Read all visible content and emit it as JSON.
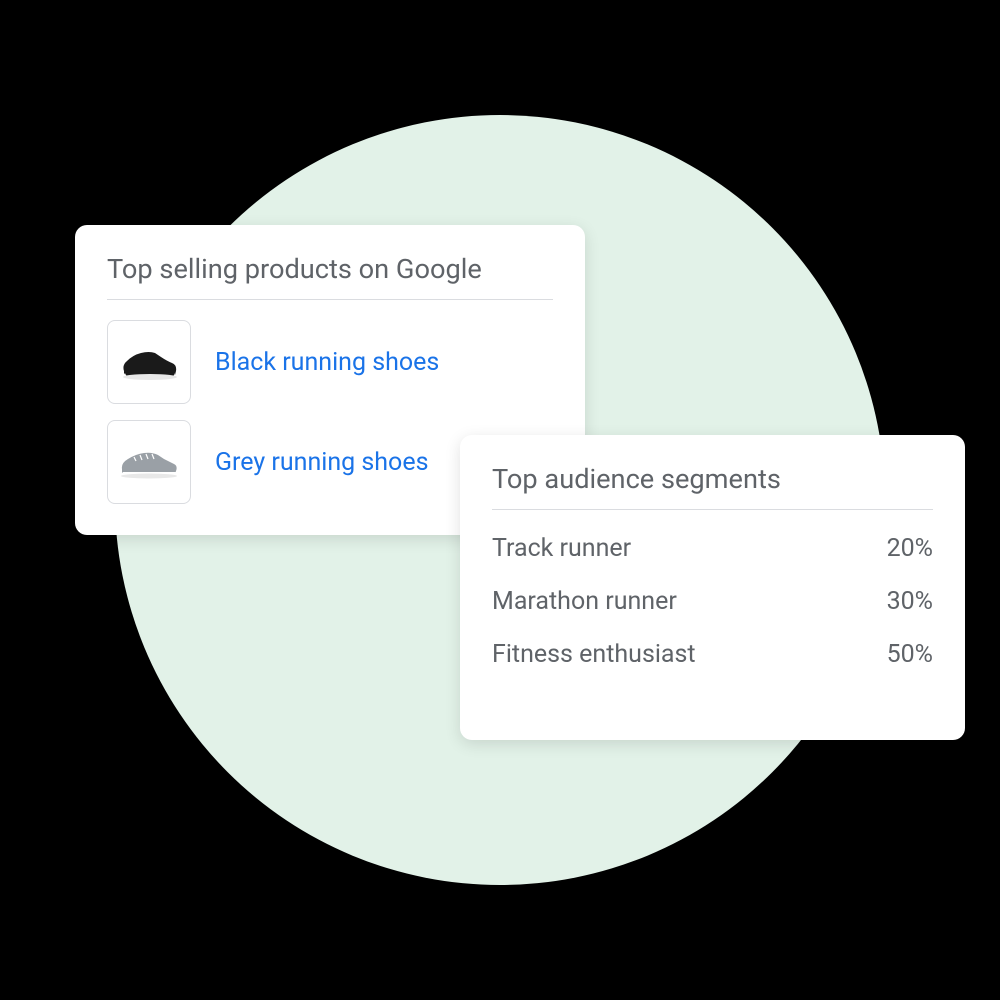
{
  "products_card": {
    "title": "Top selling products on Google",
    "items": [
      {
        "label": "Black running shoes",
        "icon": "shoe-black"
      },
      {
        "label": "Grey running shoes",
        "icon": "shoe-grey"
      }
    ]
  },
  "audience_card": {
    "title": "Top audience segments",
    "segments": [
      {
        "label": "Track runner",
        "value": "20%"
      },
      {
        "label": "Marathon runner",
        "value": "30%"
      },
      {
        "label": "Fitness enthusiast",
        "value": "50%"
      }
    ]
  },
  "colors": {
    "background_circle": "#e2f2e8",
    "link": "#1a73e8",
    "text_muted": "#5f6368"
  }
}
